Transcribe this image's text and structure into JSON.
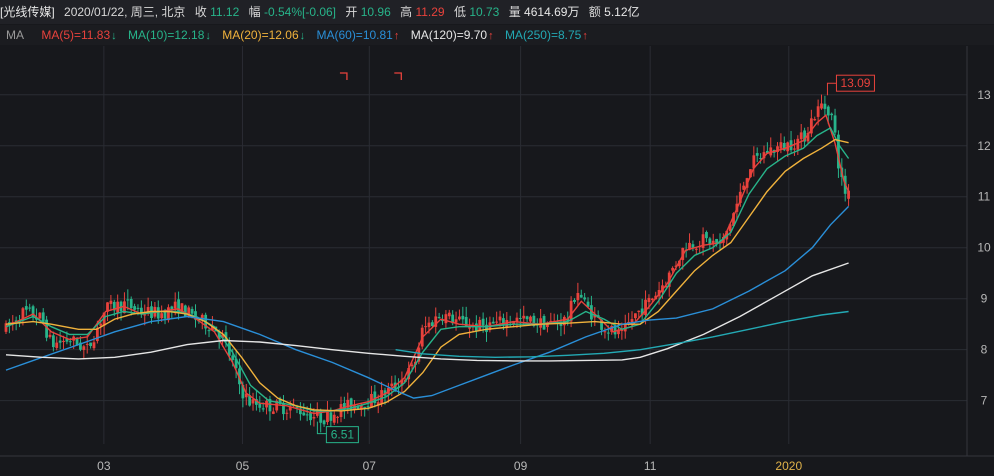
{
  "header": {
    "stock": "[光线传媒]",
    "date": "2020/01/22, 周三, 北京",
    "close_label": "收",
    "close_value": "11.12",
    "change_label": "幅",
    "change_pct": "-0.54%",
    "change_abs": "[-0.06]",
    "open_label": "开",
    "open_value": "10.96",
    "high_label": "高",
    "high_value": "11.29",
    "low_label": "低",
    "low_value": "10.73",
    "volume_label": "量",
    "volume_value": "4614.69万",
    "amount_label": "额",
    "amount_value": "5.12亿"
  },
  "ma_bar": {
    "label": "MA",
    "items": [
      {
        "text": "MA(5)=11.83",
        "arrow": "down",
        "color": "#e8423c"
      },
      {
        "text": "MA(10)=12.18",
        "arrow": "down",
        "color": "#27b48a"
      },
      {
        "text": "MA(20)=12.06",
        "arrow": "down",
        "color": "#f0b23c"
      },
      {
        "text": "MA(60)=10.81",
        "arrow": "up",
        "color": "#2a8fd8"
      },
      {
        "text": "MA(120)=9.70",
        "arrow": "up",
        "color": "#e6e6e6"
      },
      {
        "text": "MA(250)=8.75",
        "arrow": "up",
        "color": "#23a9b4"
      }
    ]
  },
  "colors": {
    "up": "#e8423c",
    "down": "#27b48a",
    "background": "#17181c",
    "grid": "#2a2c33"
  },
  "chart_data": {
    "type": "line",
    "title": "",
    "xlabel": "",
    "ylabel": "",
    "ylim": [
      6.15,
      13.8
    ],
    "yticks": [
      7,
      8,
      9,
      10,
      11,
      12,
      13
    ],
    "xlim": [
      0,
      100
    ],
    "xticks": [
      {
        "x": 10.8,
        "label": "03"
      },
      {
        "x": 26.1,
        "label": "05"
      },
      {
        "x": 40.1,
        "label": "07"
      },
      {
        "x": 56.8,
        "label": "09"
      },
      {
        "x": 71.1,
        "label": "11"
      },
      {
        "x": 86.4,
        "label": "2020"
      }
    ],
    "annotations": [
      {
        "x": 91.0,
        "y": 13.09,
        "text": "13.09"
      },
      {
        "x": 34.7,
        "y": 6.51,
        "text": "6.51"
      }
    ],
    "candle_anchors": [
      [
        0,
        8.4
      ],
      [
        2,
        8.75
      ],
      [
        4,
        8.6
      ],
      [
        5,
        8.1
      ],
      [
        7,
        8.2
      ],
      [
        9,
        8.0
      ],
      [
        11,
        8.8
      ],
      [
        13,
        8.9
      ],
      [
        15,
        8.75
      ],
      [
        17,
        8.7
      ],
      [
        19,
        8.85
      ],
      [
        21,
        8.6
      ],
      [
        23,
        8.45
      ],
      [
        24,
        8.2
      ],
      [
        25,
        7.75
      ],
      [
        26,
        7.2
      ],
      [
        27,
        6.95
      ],
      [
        29,
        6.9
      ],
      [
        32,
        6.85
      ],
      [
        34,
        6.7
      ],
      [
        35,
        6.65
      ],
      [
        37,
        6.85
      ],
      [
        39,
        6.95
      ],
      [
        41,
        7.05
      ],
      [
        43,
        7.3
      ],
      [
        45,
        7.65
      ],
      [
        46,
        8.4
      ],
      [
        48,
        8.7
      ],
      [
        50,
        8.55
      ],
      [
        52,
        8.45
      ],
      [
        54,
        8.5
      ],
      [
        56,
        8.6
      ],
      [
        58,
        8.55
      ],
      [
        60,
        8.5
      ],
      [
        62,
        8.6
      ],
      [
        63,
        9.2
      ],
      [
        64,
        8.85
      ],
      [
        66,
        8.45
      ],
      [
        68,
        8.25
      ],
      [
        69,
        8.6
      ],
      [
        71,
        8.95
      ],
      [
        73,
        9.4
      ],
      [
        75,
        10.05
      ],
      [
        77,
        10.15
      ],
      [
        79,
        10.05
      ],
      [
        81,
        11.0
      ],
      [
        82,
        11.6
      ],
      [
        84,
        11.9
      ],
      [
        86,
        12.0
      ],
      [
        88,
        12.15
      ],
      [
        89,
        12.55
      ],
      [
        90,
        12.8
      ],
      [
        91,
        12.7
      ],
      [
        91.5,
        12.2
      ],
      [
        92,
        11.5
      ],
      [
        92.5,
        11.1
      ],
      [
        93,
        11.12
      ]
    ],
    "series": [
      {
        "name": "MA(5)",
        "color": "#e8423c",
        "points": [
          [
            0,
            8.45
          ],
          [
            3,
            8.7
          ],
          [
            5,
            8.35
          ],
          [
            7,
            8.2
          ],
          [
            9,
            8.25
          ],
          [
            11,
            8.75
          ],
          [
            13,
            8.85
          ],
          [
            15,
            8.7
          ],
          [
            17,
            8.75
          ],
          [
            19,
            8.8
          ],
          [
            21,
            8.6
          ],
          [
            23,
            8.35
          ],
          [
            25,
            7.75
          ],
          [
            26.5,
            7.15
          ],
          [
            28,
            6.95
          ],
          [
            31,
            6.9
          ],
          [
            34,
            6.75
          ],
          [
            36,
            6.8
          ],
          [
            38,
            6.9
          ],
          [
            40,
            6.98
          ],
          [
            42,
            7.15
          ],
          [
            44,
            7.45
          ],
          [
            46,
            8.25
          ],
          [
            48,
            8.6
          ],
          [
            50,
            8.5
          ],
          [
            53,
            8.45
          ],
          [
            56,
            8.55
          ],
          [
            59,
            8.5
          ],
          [
            62,
            8.6
          ],
          [
            63.5,
            8.95
          ],
          [
            65,
            8.7
          ],
          [
            67,
            8.35
          ],
          [
            69,
            8.45
          ],
          [
            71,
            8.85
          ],
          [
            73,
            9.3
          ],
          [
            75,
            9.95
          ],
          [
            77,
            10.05
          ],
          [
            79,
            10.1
          ],
          [
            81,
            10.9
          ],
          [
            82.5,
            11.55
          ],
          [
            84,
            11.85
          ],
          [
            86,
            11.95
          ],
          [
            88,
            12.1
          ],
          [
            89.5,
            12.45
          ],
          [
            90.5,
            12.6
          ],
          [
            91.5,
            12.05
          ],
          [
            92.5,
            11.3
          ],
          [
            93,
            11.1
          ]
        ]
      },
      {
        "name": "MA(10)",
        "color": "#27b48a",
        "points": [
          [
            0,
            8.45
          ],
          [
            3,
            8.65
          ],
          [
            5,
            8.45
          ],
          [
            7,
            8.3
          ],
          [
            9,
            8.3
          ],
          [
            11,
            8.65
          ],
          [
            13,
            8.75
          ],
          [
            15,
            8.7
          ],
          [
            17,
            8.75
          ],
          [
            19,
            8.75
          ],
          [
            21,
            8.65
          ],
          [
            23,
            8.45
          ],
          [
            25,
            7.95
          ],
          [
            27,
            7.3
          ],
          [
            29,
            7.0
          ],
          [
            32,
            6.9
          ],
          [
            34,
            6.8
          ],
          [
            36,
            6.8
          ],
          [
            38,
            6.85
          ],
          [
            40,
            6.95
          ],
          [
            42,
            7.08
          ],
          [
            44,
            7.35
          ],
          [
            46,
            7.95
          ],
          [
            48,
            8.4
          ],
          [
            50,
            8.45
          ],
          [
            53,
            8.45
          ],
          [
            56,
            8.5
          ],
          [
            59,
            8.5
          ],
          [
            62,
            8.55
          ],
          [
            64,
            8.75
          ],
          [
            66,
            8.6
          ],
          [
            68,
            8.4
          ],
          [
            70,
            8.5
          ],
          [
            72,
            8.95
          ],
          [
            74,
            9.5
          ],
          [
            76,
            9.85
          ],
          [
            78,
            10.0
          ],
          [
            80,
            10.3
          ],
          [
            82,
            11.05
          ],
          [
            84,
            11.55
          ],
          [
            86,
            11.8
          ],
          [
            88,
            11.95
          ],
          [
            89.5,
            12.2
          ],
          [
            91,
            12.35
          ],
          [
            92,
            12.0
          ],
          [
            93,
            11.75
          ]
        ]
      },
      {
        "name": "MA(20)",
        "color": "#f0b23c",
        "points": [
          [
            0,
            8.5
          ],
          [
            3,
            8.55
          ],
          [
            5,
            8.5
          ],
          [
            8,
            8.4
          ],
          [
            10,
            8.4
          ],
          [
            12,
            8.6
          ],
          [
            14,
            8.7
          ],
          [
            16,
            8.75
          ],
          [
            18,
            8.75
          ],
          [
            20,
            8.7
          ],
          [
            22,
            8.55
          ],
          [
            24,
            8.3
          ],
          [
            26,
            7.85
          ],
          [
            28,
            7.35
          ],
          [
            30,
            7.05
          ],
          [
            32,
            6.9
          ],
          [
            34,
            6.82
          ],
          [
            37,
            6.8
          ],
          [
            40,
            6.85
          ],
          [
            42,
            6.97
          ],
          [
            44,
            7.18
          ],
          [
            46,
            7.55
          ],
          [
            48,
            8.05
          ],
          [
            50,
            8.3
          ],
          [
            53,
            8.4
          ],
          [
            56,
            8.45
          ],
          [
            59,
            8.5
          ],
          [
            62,
            8.52
          ],
          [
            65,
            8.55
          ],
          [
            68,
            8.5
          ],
          [
            70,
            8.5
          ],
          [
            72,
            8.75
          ],
          [
            74,
            9.15
          ],
          [
            76,
            9.55
          ],
          [
            78,
            9.85
          ],
          [
            80,
            10.1
          ],
          [
            82,
            10.6
          ],
          [
            84,
            11.1
          ],
          [
            86,
            11.5
          ],
          [
            88,
            11.75
          ],
          [
            90,
            11.95
          ],
          [
            91.5,
            12.12
          ],
          [
            93,
            12.06
          ]
        ]
      },
      {
        "name": "MA(60)",
        "color": "#2a8fd8",
        "points": [
          [
            0,
            7.6
          ],
          [
            4,
            7.85
          ],
          [
            8,
            8.1
          ],
          [
            12,
            8.35
          ],
          [
            16,
            8.55
          ],
          [
            20,
            8.65
          ],
          [
            24,
            8.55
          ],
          [
            28,
            8.3
          ],
          [
            32,
            8.0
          ],
          [
            36,
            7.75
          ],
          [
            40,
            7.45
          ],
          [
            43,
            7.2
          ],
          [
            45,
            7.05
          ],
          [
            47,
            7.1
          ],
          [
            50,
            7.3
          ],
          [
            53,
            7.5
          ],
          [
            56,
            7.7
          ],
          [
            60,
            7.95
          ],
          [
            64,
            8.25
          ],
          [
            68,
            8.5
          ],
          [
            71,
            8.58
          ],
          [
            74,
            8.62
          ],
          [
            78,
            8.8
          ],
          [
            82,
            9.15
          ],
          [
            86,
            9.55
          ],
          [
            89,
            10.0
          ],
          [
            91,
            10.45
          ],
          [
            93,
            10.81
          ]
        ]
      },
      {
        "name": "MA(120)",
        "color": "#e6e6e6",
        "points": [
          [
            0,
            7.9
          ],
          [
            4,
            7.85
          ],
          [
            8,
            7.82
          ],
          [
            12,
            7.85
          ],
          [
            16,
            7.95
          ],
          [
            20,
            8.1
          ],
          [
            24,
            8.18
          ],
          [
            28,
            8.15
          ],
          [
            32,
            8.08
          ],
          [
            36,
            8.0
          ],
          [
            40,
            7.93
          ],
          [
            44,
            7.87
          ],
          [
            48,
            7.82
          ],
          [
            52,
            7.79
          ],
          [
            56,
            7.78
          ],
          [
            60,
            7.78
          ],
          [
            64,
            7.79
          ],
          [
            68,
            7.8
          ],
          [
            70,
            7.85
          ],
          [
            73,
            8.02
          ],
          [
            77,
            8.3
          ],
          [
            81,
            8.65
          ],
          [
            85,
            9.05
          ],
          [
            89,
            9.45
          ],
          [
            93,
            9.7
          ]
        ]
      },
      {
        "name": "MA(250)",
        "color": "#23a9b4",
        "points": [
          [
            43,
            8.0
          ],
          [
            46,
            7.92
          ],
          [
            50,
            7.87
          ],
          [
            54,
            7.85
          ],
          [
            58,
            7.86
          ],
          [
            62,
            7.89
          ],
          [
            66,
            7.93
          ],
          [
            70,
            8.0
          ],
          [
            74,
            8.12
          ],
          [
            78,
            8.25
          ],
          [
            82,
            8.4
          ],
          [
            86,
            8.55
          ],
          [
            90,
            8.68
          ],
          [
            93,
            8.75
          ]
        ]
      }
    ]
  }
}
